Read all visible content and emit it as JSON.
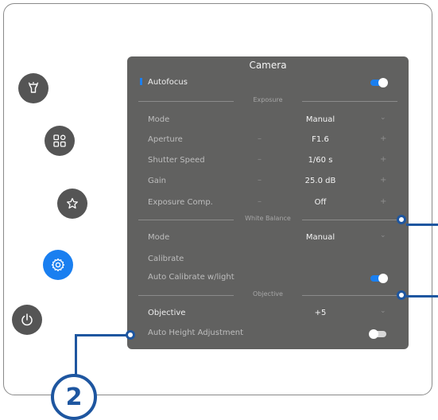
{
  "panel": {
    "title": "Camera"
  },
  "autofocus": {
    "label": "Autofocus",
    "state": "on"
  },
  "sections": {
    "exposure": "Exposure",
    "white_balance": "White Balance",
    "objective": "Objective"
  },
  "exposure_rows": [
    {
      "label": "Mode",
      "value": "Manual",
      "control": "dropdown"
    },
    {
      "label": "Aperture",
      "value": "F1.6",
      "control": "stepper"
    },
    {
      "label": "Shutter Speed",
      "value": "1/60 s",
      "control": "stepper"
    },
    {
      "label": "Gain",
      "value": "25.0 dB",
      "control": "stepper"
    },
    {
      "label": "Exposure Comp.",
      "value": "Off",
      "control": "stepper"
    }
  ],
  "white_balance_rows": {
    "mode": {
      "label": "Mode",
      "value": "Manual"
    },
    "calibrate": {
      "label": "Calibrate"
    },
    "auto_calibrate": {
      "label": "Auto Calibrate w/light",
      "state": "on"
    }
  },
  "objective_rows": {
    "objective": {
      "label": "Objective",
      "value": "+5"
    },
    "auto_height": {
      "label": "Auto Height Adjustment",
      "state": "off"
    }
  },
  "stepper": {
    "minus": "–",
    "plus": "+"
  },
  "sidebar": {
    "items": [
      {
        "icon": "lamp-icon",
        "active": false
      },
      {
        "icon": "grid-settings-icon",
        "active": false
      },
      {
        "icon": "star-icon",
        "active": false
      },
      {
        "icon": "gear-icon",
        "active": true
      },
      {
        "icon": "power-icon",
        "active": false
      }
    ]
  },
  "callout": {
    "number": "2"
  },
  "colors": {
    "accent": "#1a7ff0",
    "panel": "#616160",
    "sidebar_button": "#555555",
    "callout": "#1e56a0"
  }
}
